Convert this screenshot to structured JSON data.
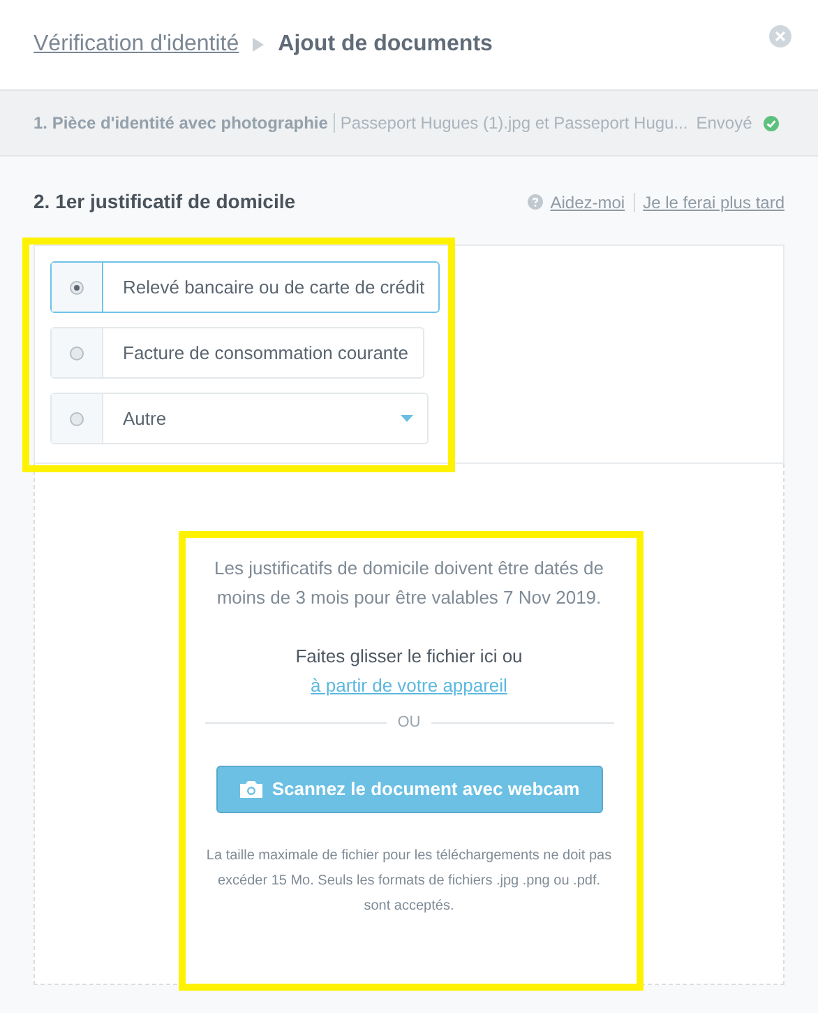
{
  "breadcrumb": {
    "parent": "Vérification d'identité",
    "current": "Ajout de documents"
  },
  "completed_step": {
    "title": "1. Pièce d'identité avec photographie",
    "files": "Passeport Hugues (1).jpg et Passeport Hugu...",
    "status": "Envoyé"
  },
  "section": {
    "title": "2. 1er justificatif de domicile",
    "links": [
      "Aidez-moi",
      "Je le ferai plus tard"
    ]
  },
  "options": [
    {
      "kind": "radio",
      "label": "Relevé bancaire ou de carte de crédit",
      "selected": true
    },
    {
      "kind": "radio",
      "label": "Facture de consommation courante",
      "selected": false
    },
    {
      "kind": "dropdown",
      "label": "Autre",
      "selected": false
    }
  ],
  "upload": {
    "notice": "Les justificatifs de domicile doivent être datés de moins de 3 mois pour être valables 7 Nov 2019.",
    "drop_text": "Faites glisser le fichier ici ou",
    "drop_link": "à partir de votre appareil",
    "separator": "OU",
    "scan_button": "Scannez le document avec webcam",
    "limits": "La taille maximale de fichier pour les téléchargements ne doit pas excéder 15 Mo. Seuls les formats de fichiers .jpg .png ou .pdf. sont acceptés."
  }
}
